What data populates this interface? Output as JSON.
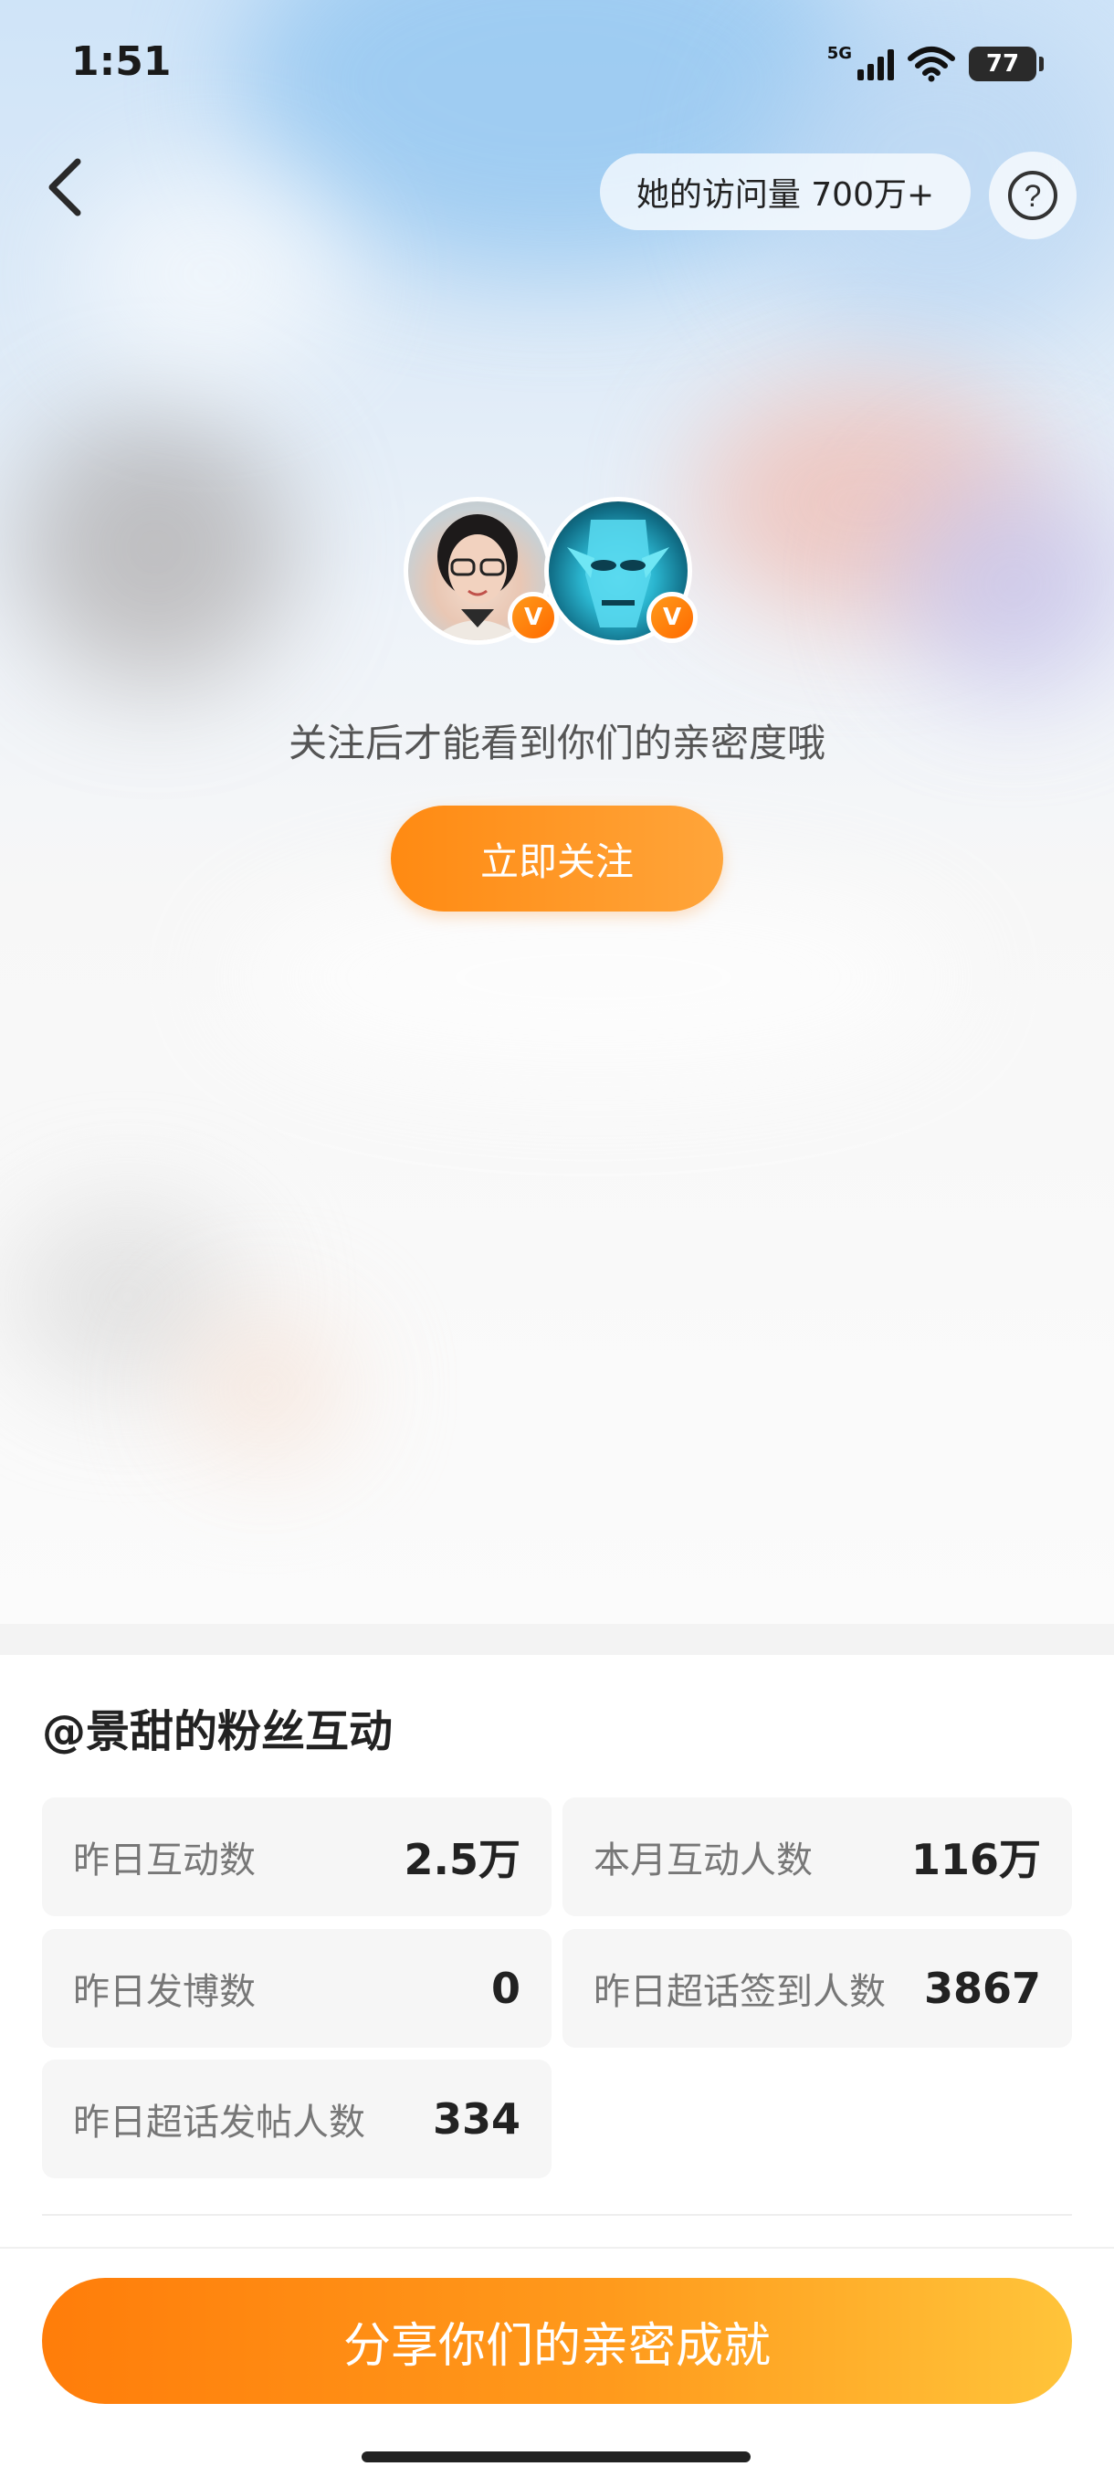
{
  "status_bar": {
    "time": "1:51",
    "network": "5G",
    "battery": "77"
  },
  "header": {
    "visits": "她的访问量 700万+",
    "help_symbol": "?"
  },
  "profile": {
    "follow_hint": "关注后才能看到你们的亲密度哦",
    "follow_button": "立即关注",
    "badge_letter": "V"
  },
  "stats": {
    "title": "@景甜的粉丝互动",
    "items": [
      {
        "label": "昨日互动数",
        "value": "2.5万"
      },
      {
        "label": "本月互动人数",
        "value": "116万"
      },
      {
        "label": "昨日发博数",
        "value": "0"
      },
      {
        "label": "昨日超话签到人数",
        "value": "3867"
      },
      {
        "label": "昨日超话发帖人数",
        "value": "334"
      }
    ]
  },
  "share": {
    "button": "分享你们的亲密成就"
  },
  "colors": {
    "accent": "#ff8a12",
    "accent_light": "#ffc43a"
  },
  "icons": {
    "back": "chevron-left-icon",
    "help": "question-circle-icon",
    "verified": "verified-v-badge-icon"
  }
}
